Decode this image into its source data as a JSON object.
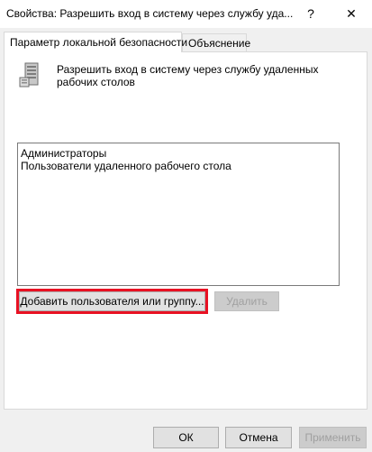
{
  "window": {
    "title": "Свойства: Разрешить вход в систему через службу уда...",
    "help_glyph": "?",
    "close_glyph": "✕"
  },
  "tabs": [
    {
      "label": "Параметр локальной безопасности",
      "active": true
    },
    {
      "label": "Объяснение",
      "active": false
    }
  ],
  "policy": {
    "icon": "server-policy-icon",
    "description": "Разрешить вход в систему через службу удаленных рабочих столов"
  },
  "listbox": {
    "items": [
      "Администраторы",
      "Пользователи удаленного рабочего стола"
    ]
  },
  "buttons": {
    "add": "Добавить пользователя или группу...",
    "remove": "Удалить",
    "ok": "ОК",
    "cancel": "Отмена",
    "apply": "Применить"
  },
  "colors": {
    "highlight_border": "#e81123",
    "disabled_text": "#a0a0a0"
  }
}
